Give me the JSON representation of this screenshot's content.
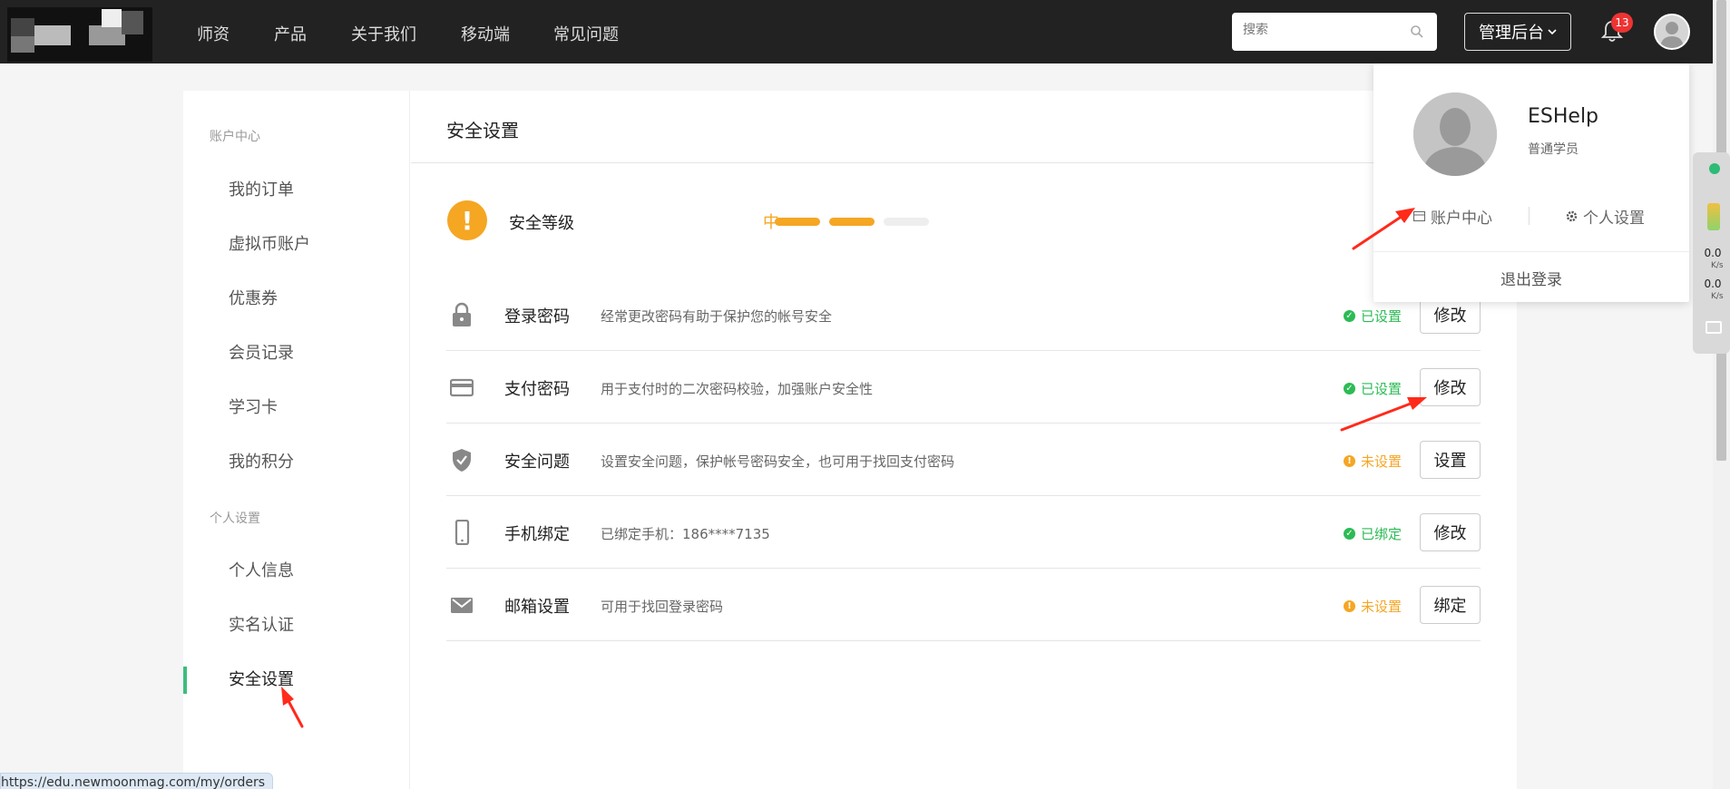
{
  "nav": {
    "links": [
      "师资",
      "产品",
      "关于我们",
      "移动端",
      "常见问题"
    ],
    "search_placeholder": "搜索",
    "admin_label": "管理后台",
    "notification_count": "13"
  },
  "sidebar": {
    "group1": "账户中心",
    "items1": [
      "我的订单",
      "虚拟币账户",
      "优惠券",
      "会员记录",
      "学习卡",
      "我的积分"
    ],
    "group2": "个人设置",
    "items2": [
      "个人信息",
      "实名认证",
      "安全设置"
    ],
    "active_item": "安全设置"
  },
  "content": {
    "title": "安全设置",
    "level_label": "安全等级",
    "level_text": "中",
    "level_filled": 2,
    "level_total": 3,
    "rows": [
      {
        "icon": "lock-icon",
        "name": "登录密码",
        "desc": "经常更改密码有助于保护您的帐号安全",
        "status": "已设置",
        "state": "ok",
        "button": "修改"
      },
      {
        "icon": "card-icon",
        "name": "支付密码",
        "desc": "用于支付时的二次密码校验，加强账户安全性",
        "status": "已设置",
        "state": "ok",
        "button": "修改"
      },
      {
        "icon": "shield-icon",
        "name": "安全问题",
        "desc": "设置安全问题，保护帐号密码安全，也可用于找回支付密码",
        "status": "未设置",
        "state": "warn",
        "button": "设置"
      },
      {
        "icon": "phone-icon",
        "name": "手机绑定",
        "desc": "已绑定手机：186****7135",
        "status": "已绑定",
        "state": "ok",
        "button": "修改"
      },
      {
        "icon": "mail-icon",
        "name": "邮箱设置",
        "desc": "可用于找回登录密码",
        "status": "未设置",
        "state": "warn",
        "button": "绑定"
      }
    ]
  },
  "dropdown": {
    "username": "ESHelp",
    "role": "普通学员",
    "account_link": "账户中心",
    "settings_link": "个人设置",
    "logout": "退出登录"
  },
  "speed_widget": {
    "upload": "0.0",
    "download": "0.0",
    "unit": "K/s"
  },
  "status_url": "https://edu.newmoonmag.com/my/orders",
  "colors": {
    "accent_green": "#3dbd7d",
    "warn_orange": "#f5a623",
    "ok_green": "#2dbb55",
    "nav_bg": "#222222",
    "annotation_red": "#ff2a1a"
  }
}
